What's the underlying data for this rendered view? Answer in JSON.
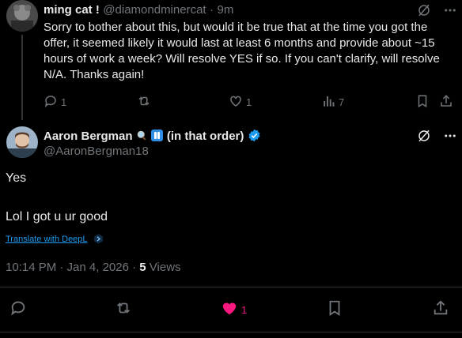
{
  "reply": {
    "author_name": "ming cat !",
    "handle": "@diamondminercat",
    "sep": "·",
    "time": "9m",
    "text": "Sorry to bother about this, but would it be true that at the time you got the offer, it seemed likely it would last at least 6 months and provide about ~15 hours of work a week? Will resolve YES if so. If you can't clarify, will resolve N/A. Thanks again!",
    "reply_count": "1",
    "like_count": "1",
    "view_count": "7"
  },
  "main": {
    "author_name": "Aaron Bergman",
    "author_suffix": "(in that order)",
    "handle": "@AaronBergman18",
    "line1": "Yes",
    "line2": "Lol I got u ur good",
    "translate_label": "Translate with DeepL",
    "timestamp": "10:14 PM · Jan 4, 2026 ·",
    "views_count": "5",
    "views_label": "Views",
    "like_count": "1"
  },
  "colors": {
    "background": "#000000",
    "text": "#e7e9ea",
    "muted": "#71767b",
    "accent": "#1d9bf0",
    "like": "#f91880",
    "divider": "#2f3336"
  },
  "icons": [
    "grok-icon",
    "reply-icon",
    "retweet-icon",
    "like-icon",
    "views-icon",
    "bookmark-icon",
    "share-icon",
    "magnifier-emoji-icon",
    "pause-emoji-icon",
    "verified-badge-icon",
    "deepl-icon"
  ]
}
